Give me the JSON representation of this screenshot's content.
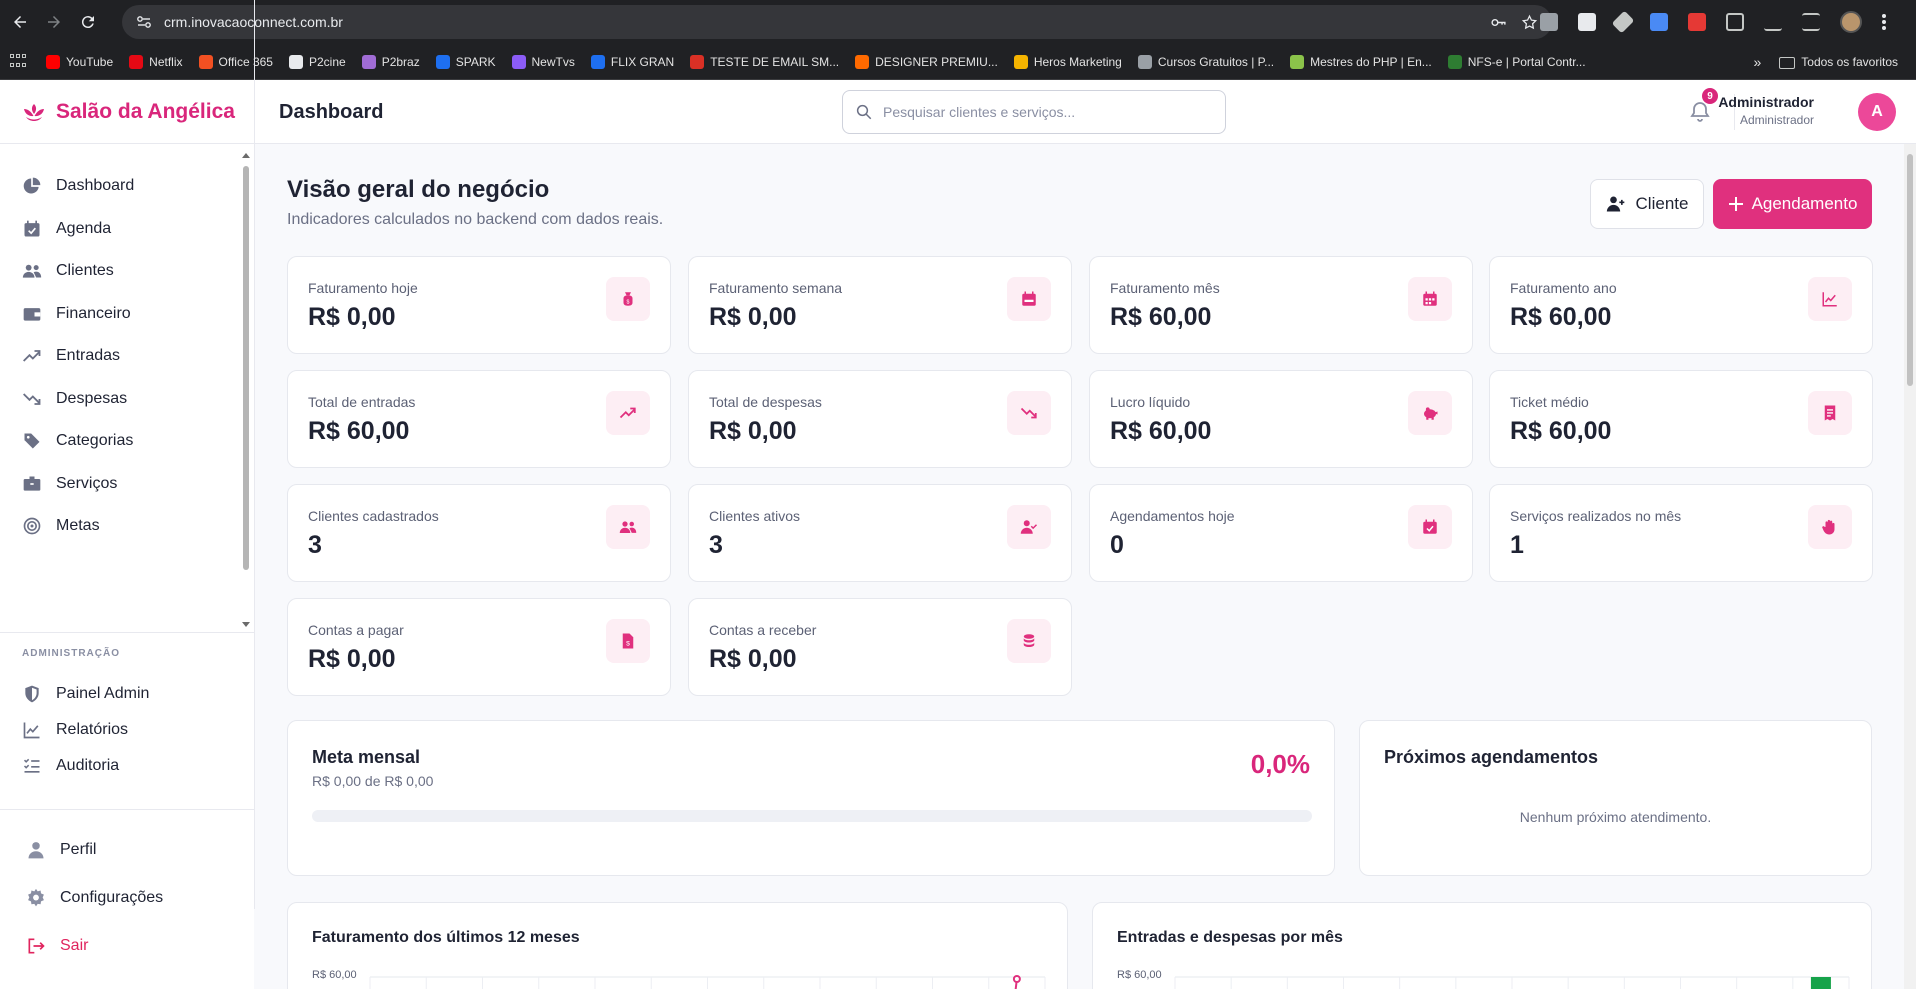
{
  "browser": {
    "url": "crm.inovacaoconnect.com.br",
    "bookmarks": [
      {
        "label": "YouTube",
        "color": "#ff0000"
      },
      {
        "label": "Netflix",
        "color": "#e50914"
      },
      {
        "label": "Office 365",
        "color": "#f25022"
      },
      {
        "label": "P2cine",
        "color": "#e8eaed"
      },
      {
        "label": "P2braz",
        "color": "#a06cd5"
      },
      {
        "label": "SPARK",
        "color": "#1e6ff0"
      },
      {
        "label": "NewTvs",
        "color": "#8b5cf6"
      },
      {
        "label": "FLIX GRAN",
        "color": "#1e6ff0"
      },
      {
        "label": "TESTE DE EMAIL SM...",
        "color": "#d93025"
      },
      {
        "label": "DESIGNER PREMIU...",
        "color": "#ff6a00"
      },
      {
        "label": "Heros Marketing",
        "color": "#f5b400"
      },
      {
        "label": "Cursos Gratuitos | P...",
        "color": "#9aa0a6"
      },
      {
        "label": "Mestres do PHP | En...",
        "color": "#8bc34a"
      },
      {
        "label": "NFS-e | Portal Contr...",
        "color": "#2e7d32"
      }
    ],
    "all_bookmarks_label": "Todos os favoritos"
  },
  "header": {
    "brand": "Salão da Angélica",
    "page_title": "Dashboard",
    "search_placeholder": "Pesquisar clientes e serviços...",
    "notification_count": "9",
    "user_name": "Administrador",
    "user_role": "Administrador",
    "avatar_initial": "A"
  },
  "sidebar": {
    "items": [
      {
        "label": "Dashboard",
        "icon": "chart-pie-icon"
      },
      {
        "label": "Agenda",
        "icon": "calendar-check-icon"
      },
      {
        "label": "Clientes",
        "icon": "users-icon"
      },
      {
        "label": "Financeiro",
        "icon": "wallet-icon"
      },
      {
        "label": "Entradas",
        "icon": "trend-up-icon"
      },
      {
        "label": "Despesas",
        "icon": "trend-down-icon"
      },
      {
        "label": "Categorias",
        "icon": "tags-icon"
      },
      {
        "label": "Serviços",
        "icon": "box-icon"
      },
      {
        "label": "Metas",
        "icon": "target-icon"
      }
    ],
    "admin_section_label": "ADMINISTRAÇÃO",
    "admin_items": [
      {
        "label": "Painel Admin",
        "icon": "shield-icon"
      },
      {
        "label": "Relatórios",
        "icon": "line-chart-icon"
      },
      {
        "label": "Auditoria",
        "icon": "list-check-icon"
      }
    ],
    "bottom_items": [
      {
        "label": "Perfil",
        "icon": "user-icon"
      },
      {
        "label": "Configurações",
        "icon": "gear-icon"
      },
      {
        "label": "Sair",
        "icon": "logout-icon"
      }
    ]
  },
  "main": {
    "title": "Visão geral do negócio",
    "subtitle": "Indicadores calculados no backend com dados reais.",
    "btn_client": "Cliente",
    "btn_appointment": "Agendamento",
    "accent": "#e0307e",
    "cards": [
      {
        "label": "Faturamento hoje",
        "value": "R$ 0,00",
        "icon": "money-bag-icon"
      },
      {
        "label": "Faturamento semana",
        "value": "R$ 0,00",
        "icon": "calendar-week-icon"
      },
      {
        "label": "Faturamento mês",
        "value": "R$ 60,00",
        "icon": "calendar-days-icon"
      },
      {
        "label": "Faturamento ano",
        "value": "R$ 60,00",
        "icon": "chart-line-icon"
      },
      {
        "label": "Total de entradas",
        "value": "R$ 60,00",
        "icon": "arrow-trend-up-icon"
      },
      {
        "label": "Total de despesas",
        "value": "R$ 0,00",
        "icon": "arrow-trend-down-icon"
      },
      {
        "label": "Lucro líquido",
        "value": "R$ 60,00",
        "icon": "piggy-bank-icon"
      },
      {
        "label": "Ticket médio",
        "value": "R$ 60,00",
        "icon": "receipt-icon"
      },
      {
        "label": "Clientes cadastrados",
        "value": "3",
        "icon": "users-icon"
      },
      {
        "label": "Clientes ativos",
        "value": "3",
        "icon": "user-check-icon"
      },
      {
        "label": "Agendamentos hoje",
        "value": "0",
        "icon": "calendar-check-icon"
      },
      {
        "label": "Serviços realizados no mês",
        "value": "1",
        "icon": "hand-sparkles-icon"
      },
      {
        "label": "Contas a pagar",
        "value": "R$ 0,00",
        "icon": "file-invoice-dollar-icon"
      },
      {
        "label": "Contas a receber",
        "value": "R$ 0,00",
        "icon": "coins-icon"
      }
    ],
    "goal": {
      "title": "Meta mensal",
      "subtitle": "R$ 0,00 de R$ 0,00",
      "percent_label": "0,0%",
      "progress": 0
    },
    "upcoming": {
      "title": "Próximos agendamentos",
      "empty_text": "Nenhum próximo atendimento."
    },
    "charts": [
      {
        "title": "Faturamento dos últimos 12 meses",
        "y_tick_top": "R$ 60,00"
      },
      {
        "title": "Entradas e despesas por mês",
        "y_tick_top": "R$ 60,00"
      }
    ]
  },
  "chart_data": [
    {
      "type": "line",
      "title": "Faturamento dos últimos 12 meses",
      "y_tick_labels": [
        "R$ 60,00"
      ],
      "series": [
        {
          "color": "#e0307e"
        }
      ]
    },
    {
      "type": "bar",
      "title": "Entradas e despesas por mês",
      "y_tick_labels": [
        "R$ 60,00"
      ],
      "series": [
        {
          "color": "#16a34a"
        }
      ]
    }
  ]
}
